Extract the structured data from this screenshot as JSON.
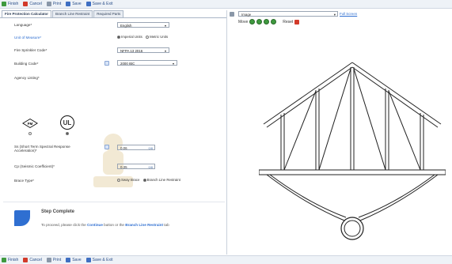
{
  "toolbar": {
    "finish": "Finish",
    "cancel": "Cancel",
    "print": "Print",
    "save": "Save",
    "save_exit": "Save & Exit"
  },
  "tabs": [
    {
      "label": "Fire Protection Calculator",
      "active": true
    },
    {
      "label": "Branch Line Restraint",
      "active": false
    },
    {
      "label": "Required Parts",
      "active": false
    }
  ],
  "form": {
    "language": {
      "label": "Language*",
      "value": "English"
    },
    "unit_of_measure": {
      "label": "Unit of Measure*",
      "options": [
        "Imperial Units",
        "Metric Units"
      ],
      "selected": "Imperial Units"
    },
    "fire_sprinkler_code": {
      "label": "Fire Sprinkler Code*",
      "value": "NFPA 13 2016"
    },
    "building_code": {
      "label": "Building Code*",
      "value": "2000 IBC"
    },
    "agency_listing": {
      "label": "Agency Listing*",
      "options": [
        "FM APPROVED",
        "UL"
      ],
      "selected": "UL"
    },
    "ss": {
      "label_line1": "Ss (Short Term Spectral Response",
      "label_line2": "Acceleration)*",
      "value": "0.06",
      "counter": "0/8"
    },
    "cp": {
      "label": "Cp (Seismic Coefficient)*",
      "value": "0.35",
      "counter": "0/8"
    },
    "brace_type": {
      "label": "Brace Type*",
      "options": [
        "Sway Brace",
        "Branch Line Restraint"
      ],
      "selected": "Branch Line Restraint"
    }
  },
  "step": {
    "title": "Step Complete",
    "msg_prefix": "To proceed, please click the",
    "msg_continue": "Continue",
    "msg_mid": "button or the",
    "msg_tab": "Branch Line Restraint",
    "msg_suffix": "tab"
  },
  "right": {
    "dropdown_value": "Image",
    "link": "Full Screen",
    "move_label": "Move",
    "reset_label": "Reset"
  },
  "colors": {
    "accent": "#2f6fd1",
    "green": "#3f9a3f",
    "red": "#d23a2a"
  }
}
